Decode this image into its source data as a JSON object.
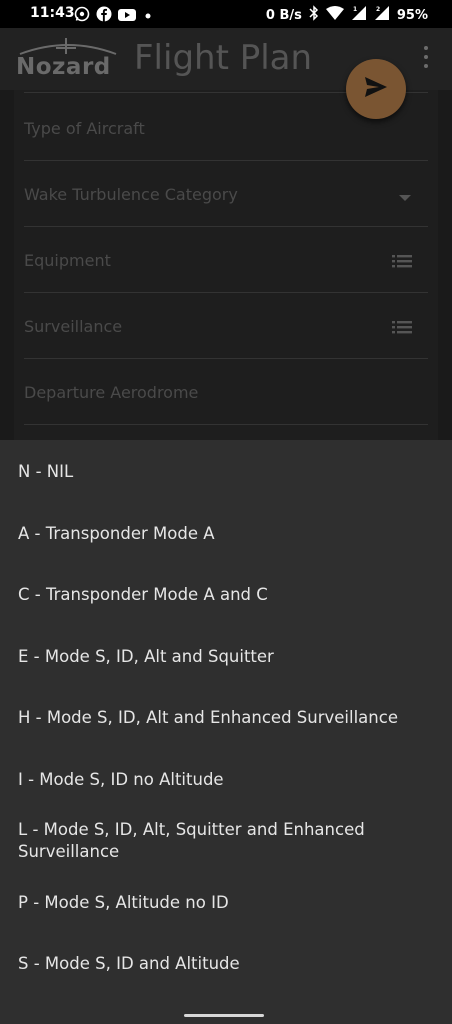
{
  "status_bar": {
    "time": "11:43",
    "net_speed": "0 B/s",
    "battery": "95%",
    "left_icons": [
      "whatsapp-icon",
      "facebook-icon",
      "youtube-icon",
      "dot-icon"
    ],
    "right_icons": [
      "bluetooth-icon",
      "wifi-icon",
      "signal-icon",
      "signal-icon",
      "battery-icon"
    ]
  },
  "header": {
    "logo_text": "Nozard",
    "title": "Flight Plan",
    "menu_icon": "more-vert-icon"
  },
  "fab": {
    "icon": "send-icon",
    "color": "#7a5532"
  },
  "form": {
    "fields": [
      {
        "label": "Type of Aircraft",
        "icon": ""
      },
      {
        "label": "Wake Turbulence Category",
        "icon": "arrow-drop-down-icon"
      },
      {
        "label": "Equipment",
        "icon": "list-icon"
      },
      {
        "label": "Surveillance",
        "icon": "list-icon"
      },
      {
        "label": "Departure Aerodrome",
        "icon": ""
      }
    ]
  },
  "sheet": {
    "options": [
      {
        "label": "N - NIL"
      },
      {
        "label": "A - Transponder Mode A"
      },
      {
        "label": "C - Transponder Mode A and C"
      },
      {
        "label": "E - Mode S, ID, Alt and Squitter"
      },
      {
        "label": "H - Mode S, ID, Alt and Enhanced Surveillance"
      },
      {
        "label": "I - Mode S, ID no Altitude"
      },
      {
        "label": "L - Mode S, ID, Alt, Squitter and Enhanced Surveillance"
      },
      {
        "label": "P - Mode S, Altitude no ID"
      },
      {
        "label": "S - Mode S, ID and Altitude"
      }
    ]
  }
}
